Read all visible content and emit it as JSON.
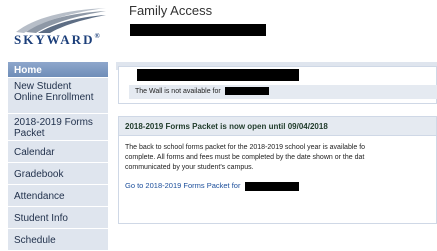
{
  "header": {
    "logo_text": "SKYWARD",
    "logo_mark": "®",
    "app_title": "Family Access"
  },
  "sidebar": {
    "items": [
      {
        "label": "Home"
      },
      {
        "label": "New Student Online Enrollment"
      },
      {
        "label": "2018-2019 Forms Packet"
      },
      {
        "label": "Calendar"
      },
      {
        "label": "Gradebook"
      },
      {
        "label": "Attendance"
      },
      {
        "label": "Student Info"
      },
      {
        "label": "Schedule"
      }
    ]
  },
  "wall": {
    "notice": "The Wall is not available for"
  },
  "forms_panel": {
    "title": "2018-2019 Forms Packet is now open until 09/04/2018",
    "body_lines": [
      "The back to school forms packet for the 2018-2019 school year is available fo",
      "complete. All forms and fees must be completed by the date shown or the dat",
      "communicated by your student's campus."
    ],
    "link_text": "Go to 2018-2019 Forms Packet for"
  },
  "colors": {
    "nav_bg": "#dfe5ee",
    "nav_active": "#7a96c0",
    "link": "#1b4e9b"
  }
}
